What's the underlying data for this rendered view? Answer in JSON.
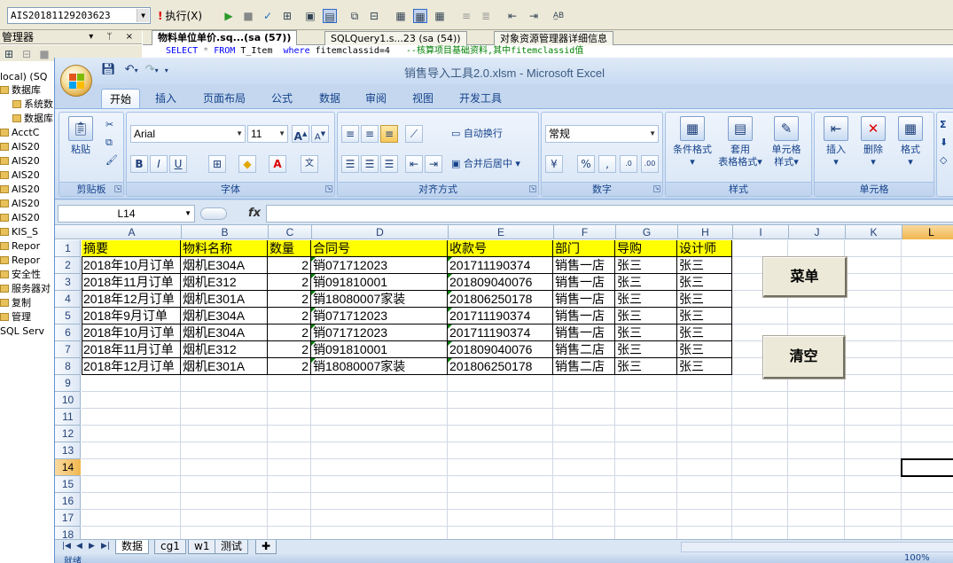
{
  "ssms": {
    "db_combo": "AIS20181129203623",
    "execute_label": "执行(X)",
    "object_explorer_title": "管理器",
    "object_explorer_controls": "▾ ᛘ ×",
    "tree_items": [
      {
        "label": "local) (SQ",
        "icon": false
      },
      {
        "label": "数据库",
        "icon": true
      },
      {
        "label": "系统数",
        "icon": true
      },
      {
        "label": "数据库",
        "icon": true
      },
      {
        "label": "AcctC",
        "icon": true
      },
      {
        "label": "AIS20",
        "icon": true
      },
      {
        "label": "AIS20",
        "icon": true
      },
      {
        "label": "AIS20",
        "icon": true
      },
      {
        "label": "AIS20",
        "icon": true
      },
      {
        "label": "AIS20",
        "icon": true
      },
      {
        "label": "AIS20",
        "icon": true
      },
      {
        "label": "KIS_S",
        "icon": true
      },
      {
        "label": "Repor",
        "icon": true
      },
      {
        "label": "Repor",
        "icon": true
      },
      {
        "label": "安全性",
        "icon": true
      },
      {
        "label": "服务器对",
        "icon": true
      },
      {
        "label": "复制",
        "icon": true
      },
      {
        "label": "管理",
        "icon": true
      },
      {
        "label": "SQL Serv",
        "icon": false
      }
    ],
    "doc_tabs": [
      "物料单位单价.sq...(sa (57))",
      "SQLQuery1.s...23 (sa (54))",
      "对象资源管理器详细信息"
    ],
    "sql_kw1": "SELECT",
    "sql_star": "*",
    "sql_kw2": "FROM",
    "sql_table": "T_Item",
    "sql_where": "where",
    "sql_cond": "fitemclassid=4",
    "sql_comment": "--核算项目基础资料,其中fitemclassid值"
  },
  "excel": {
    "title": "销售导入工具2.0.xlsm - Microsoft Excel",
    "tabs": [
      "开始",
      "插入",
      "页面布局",
      "公式",
      "数据",
      "审阅",
      "视图",
      "开发工具"
    ],
    "clipboard": {
      "paste": "粘贴",
      "label": "剪贴板"
    },
    "font": {
      "name": "Arial",
      "size": "11",
      "label": "字体"
    },
    "alignment": {
      "wrap": "自动换行",
      "merge": "合并后居中",
      "label": "对齐方式"
    },
    "number": {
      "format": "常规",
      "label": "数字"
    },
    "styles": {
      "cond": "条件格式",
      "table1": "套用",
      "table2": "表格格式",
      "cell1": "单元格",
      "cell2": "样式",
      "label": "样式"
    },
    "cells_group": {
      "insert": "插入",
      "delete": "删除",
      "format": "格式",
      "label": "单元格"
    },
    "name_box": "L14",
    "fx": "fx",
    "columns": [
      "A",
      "B",
      "C",
      "D",
      "E",
      "F",
      "G",
      "H",
      "I",
      "J",
      "K",
      "L"
    ],
    "rows": [
      "1",
      "2",
      "3",
      "4",
      "5",
      "6",
      "7",
      "8",
      "9",
      "10",
      "11",
      "12",
      "13",
      "14",
      "15",
      "16",
      "17",
      "18"
    ],
    "selected_column": "L",
    "selected_row": "14",
    "table_header": [
      "摘要",
      "物料名称",
      "数量",
      "合同号",
      "收款号",
      "部门",
      "导购",
      "设计师"
    ],
    "table_rows": [
      [
        "2018年10月订单",
        "烟机E304A",
        "2",
        "销071712023",
        "201711190374",
        "销售一店",
        "张三",
        "张三"
      ],
      [
        "2018年11月订单",
        "烟机E312",
        "2",
        "销091810001",
        "201809040076",
        "销售一店",
        "张三",
        "张三"
      ],
      [
        "2018年12月订单",
        "烟机E301A",
        "2",
        "销18080007家装",
        "201806250178",
        "销售一店",
        "张三",
        "张三"
      ],
      [
        "2018年9月订单",
        "烟机E304A",
        "2",
        "销071712023",
        "201711190374",
        "销售一店",
        "张三",
        "张三"
      ],
      [
        "2018年10月订单",
        "烟机E304A",
        "2",
        "销071712023",
        "201711190374",
        "销售一店",
        "张三",
        "张三"
      ],
      [
        "2018年11月订单",
        "烟机E312",
        "2",
        "销091810001",
        "201809040076",
        "销售二店",
        "张三",
        "张三"
      ],
      [
        "2018年12月订单",
        "烟机E301A",
        "2",
        "销18080007家装",
        "201806250178",
        "销售二店",
        "张三",
        "张三"
      ]
    ],
    "buttons": {
      "menu": "菜单",
      "clear": "清空"
    },
    "sheet_tabs": [
      "数据",
      "cg1",
      "w1",
      "测试"
    ],
    "status": {
      "ready": "就绪",
      "zoom": "100%"
    },
    "colors": {
      "header_fill": "#ffff00",
      "selection": "#f1b74e"
    }
  }
}
